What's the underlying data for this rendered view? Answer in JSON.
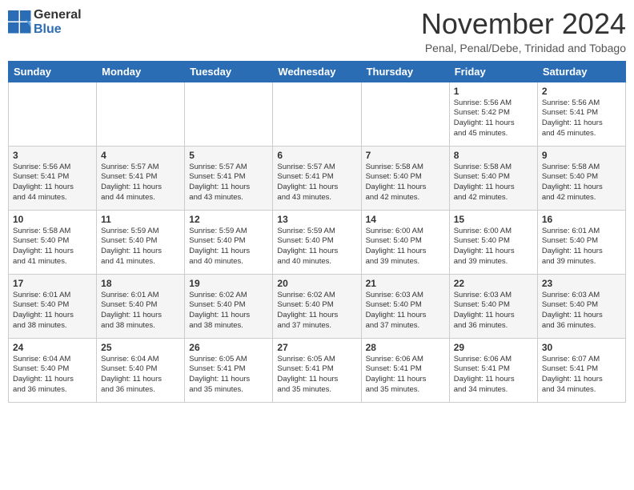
{
  "logo": {
    "general": "General",
    "blue": "Blue"
  },
  "title": "November 2024",
  "subtitle": "Penal, Penal/Debe, Trinidad and Tobago",
  "days_of_week": [
    "Sunday",
    "Monday",
    "Tuesday",
    "Wednesday",
    "Thursday",
    "Friday",
    "Saturday"
  ],
  "weeks": [
    [
      {
        "day": "",
        "info": ""
      },
      {
        "day": "",
        "info": ""
      },
      {
        "day": "",
        "info": ""
      },
      {
        "day": "",
        "info": ""
      },
      {
        "day": "",
        "info": ""
      },
      {
        "day": "1",
        "info": "Sunrise: 5:56 AM\nSunset: 5:42 PM\nDaylight: 11 hours\nand 45 minutes."
      },
      {
        "day": "2",
        "info": "Sunrise: 5:56 AM\nSunset: 5:41 PM\nDaylight: 11 hours\nand 45 minutes."
      }
    ],
    [
      {
        "day": "3",
        "info": "Sunrise: 5:56 AM\nSunset: 5:41 PM\nDaylight: 11 hours\nand 44 minutes."
      },
      {
        "day": "4",
        "info": "Sunrise: 5:57 AM\nSunset: 5:41 PM\nDaylight: 11 hours\nand 44 minutes."
      },
      {
        "day": "5",
        "info": "Sunrise: 5:57 AM\nSunset: 5:41 PM\nDaylight: 11 hours\nand 43 minutes."
      },
      {
        "day": "6",
        "info": "Sunrise: 5:57 AM\nSunset: 5:41 PM\nDaylight: 11 hours\nand 43 minutes."
      },
      {
        "day": "7",
        "info": "Sunrise: 5:58 AM\nSunset: 5:40 PM\nDaylight: 11 hours\nand 42 minutes."
      },
      {
        "day": "8",
        "info": "Sunrise: 5:58 AM\nSunset: 5:40 PM\nDaylight: 11 hours\nand 42 minutes."
      },
      {
        "day": "9",
        "info": "Sunrise: 5:58 AM\nSunset: 5:40 PM\nDaylight: 11 hours\nand 42 minutes."
      }
    ],
    [
      {
        "day": "10",
        "info": "Sunrise: 5:58 AM\nSunset: 5:40 PM\nDaylight: 11 hours\nand 41 minutes."
      },
      {
        "day": "11",
        "info": "Sunrise: 5:59 AM\nSunset: 5:40 PM\nDaylight: 11 hours\nand 41 minutes."
      },
      {
        "day": "12",
        "info": "Sunrise: 5:59 AM\nSunset: 5:40 PM\nDaylight: 11 hours\nand 40 minutes."
      },
      {
        "day": "13",
        "info": "Sunrise: 5:59 AM\nSunset: 5:40 PM\nDaylight: 11 hours\nand 40 minutes."
      },
      {
        "day": "14",
        "info": "Sunrise: 6:00 AM\nSunset: 5:40 PM\nDaylight: 11 hours\nand 39 minutes."
      },
      {
        "day": "15",
        "info": "Sunrise: 6:00 AM\nSunset: 5:40 PM\nDaylight: 11 hours\nand 39 minutes."
      },
      {
        "day": "16",
        "info": "Sunrise: 6:01 AM\nSunset: 5:40 PM\nDaylight: 11 hours\nand 39 minutes."
      }
    ],
    [
      {
        "day": "17",
        "info": "Sunrise: 6:01 AM\nSunset: 5:40 PM\nDaylight: 11 hours\nand 38 minutes."
      },
      {
        "day": "18",
        "info": "Sunrise: 6:01 AM\nSunset: 5:40 PM\nDaylight: 11 hours\nand 38 minutes."
      },
      {
        "day": "19",
        "info": "Sunrise: 6:02 AM\nSunset: 5:40 PM\nDaylight: 11 hours\nand 38 minutes."
      },
      {
        "day": "20",
        "info": "Sunrise: 6:02 AM\nSunset: 5:40 PM\nDaylight: 11 hours\nand 37 minutes."
      },
      {
        "day": "21",
        "info": "Sunrise: 6:03 AM\nSunset: 5:40 PM\nDaylight: 11 hours\nand 37 minutes."
      },
      {
        "day": "22",
        "info": "Sunrise: 6:03 AM\nSunset: 5:40 PM\nDaylight: 11 hours\nand 36 minutes."
      },
      {
        "day": "23",
        "info": "Sunrise: 6:03 AM\nSunset: 5:40 PM\nDaylight: 11 hours\nand 36 minutes."
      }
    ],
    [
      {
        "day": "24",
        "info": "Sunrise: 6:04 AM\nSunset: 5:40 PM\nDaylight: 11 hours\nand 36 minutes."
      },
      {
        "day": "25",
        "info": "Sunrise: 6:04 AM\nSunset: 5:40 PM\nDaylight: 11 hours\nand 36 minutes."
      },
      {
        "day": "26",
        "info": "Sunrise: 6:05 AM\nSunset: 5:41 PM\nDaylight: 11 hours\nand 35 minutes."
      },
      {
        "day": "27",
        "info": "Sunrise: 6:05 AM\nSunset: 5:41 PM\nDaylight: 11 hours\nand 35 minutes."
      },
      {
        "day": "28",
        "info": "Sunrise: 6:06 AM\nSunset: 5:41 PM\nDaylight: 11 hours\nand 35 minutes."
      },
      {
        "day": "29",
        "info": "Sunrise: 6:06 AM\nSunset: 5:41 PM\nDaylight: 11 hours\nand 34 minutes."
      },
      {
        "day": "30",
        "info": "Sunrise: 6:07 AM\nSunset: 5:41 PM\nDaylight: 11 hours\nand 34 minutes."
      }
    ]
  ]
}
